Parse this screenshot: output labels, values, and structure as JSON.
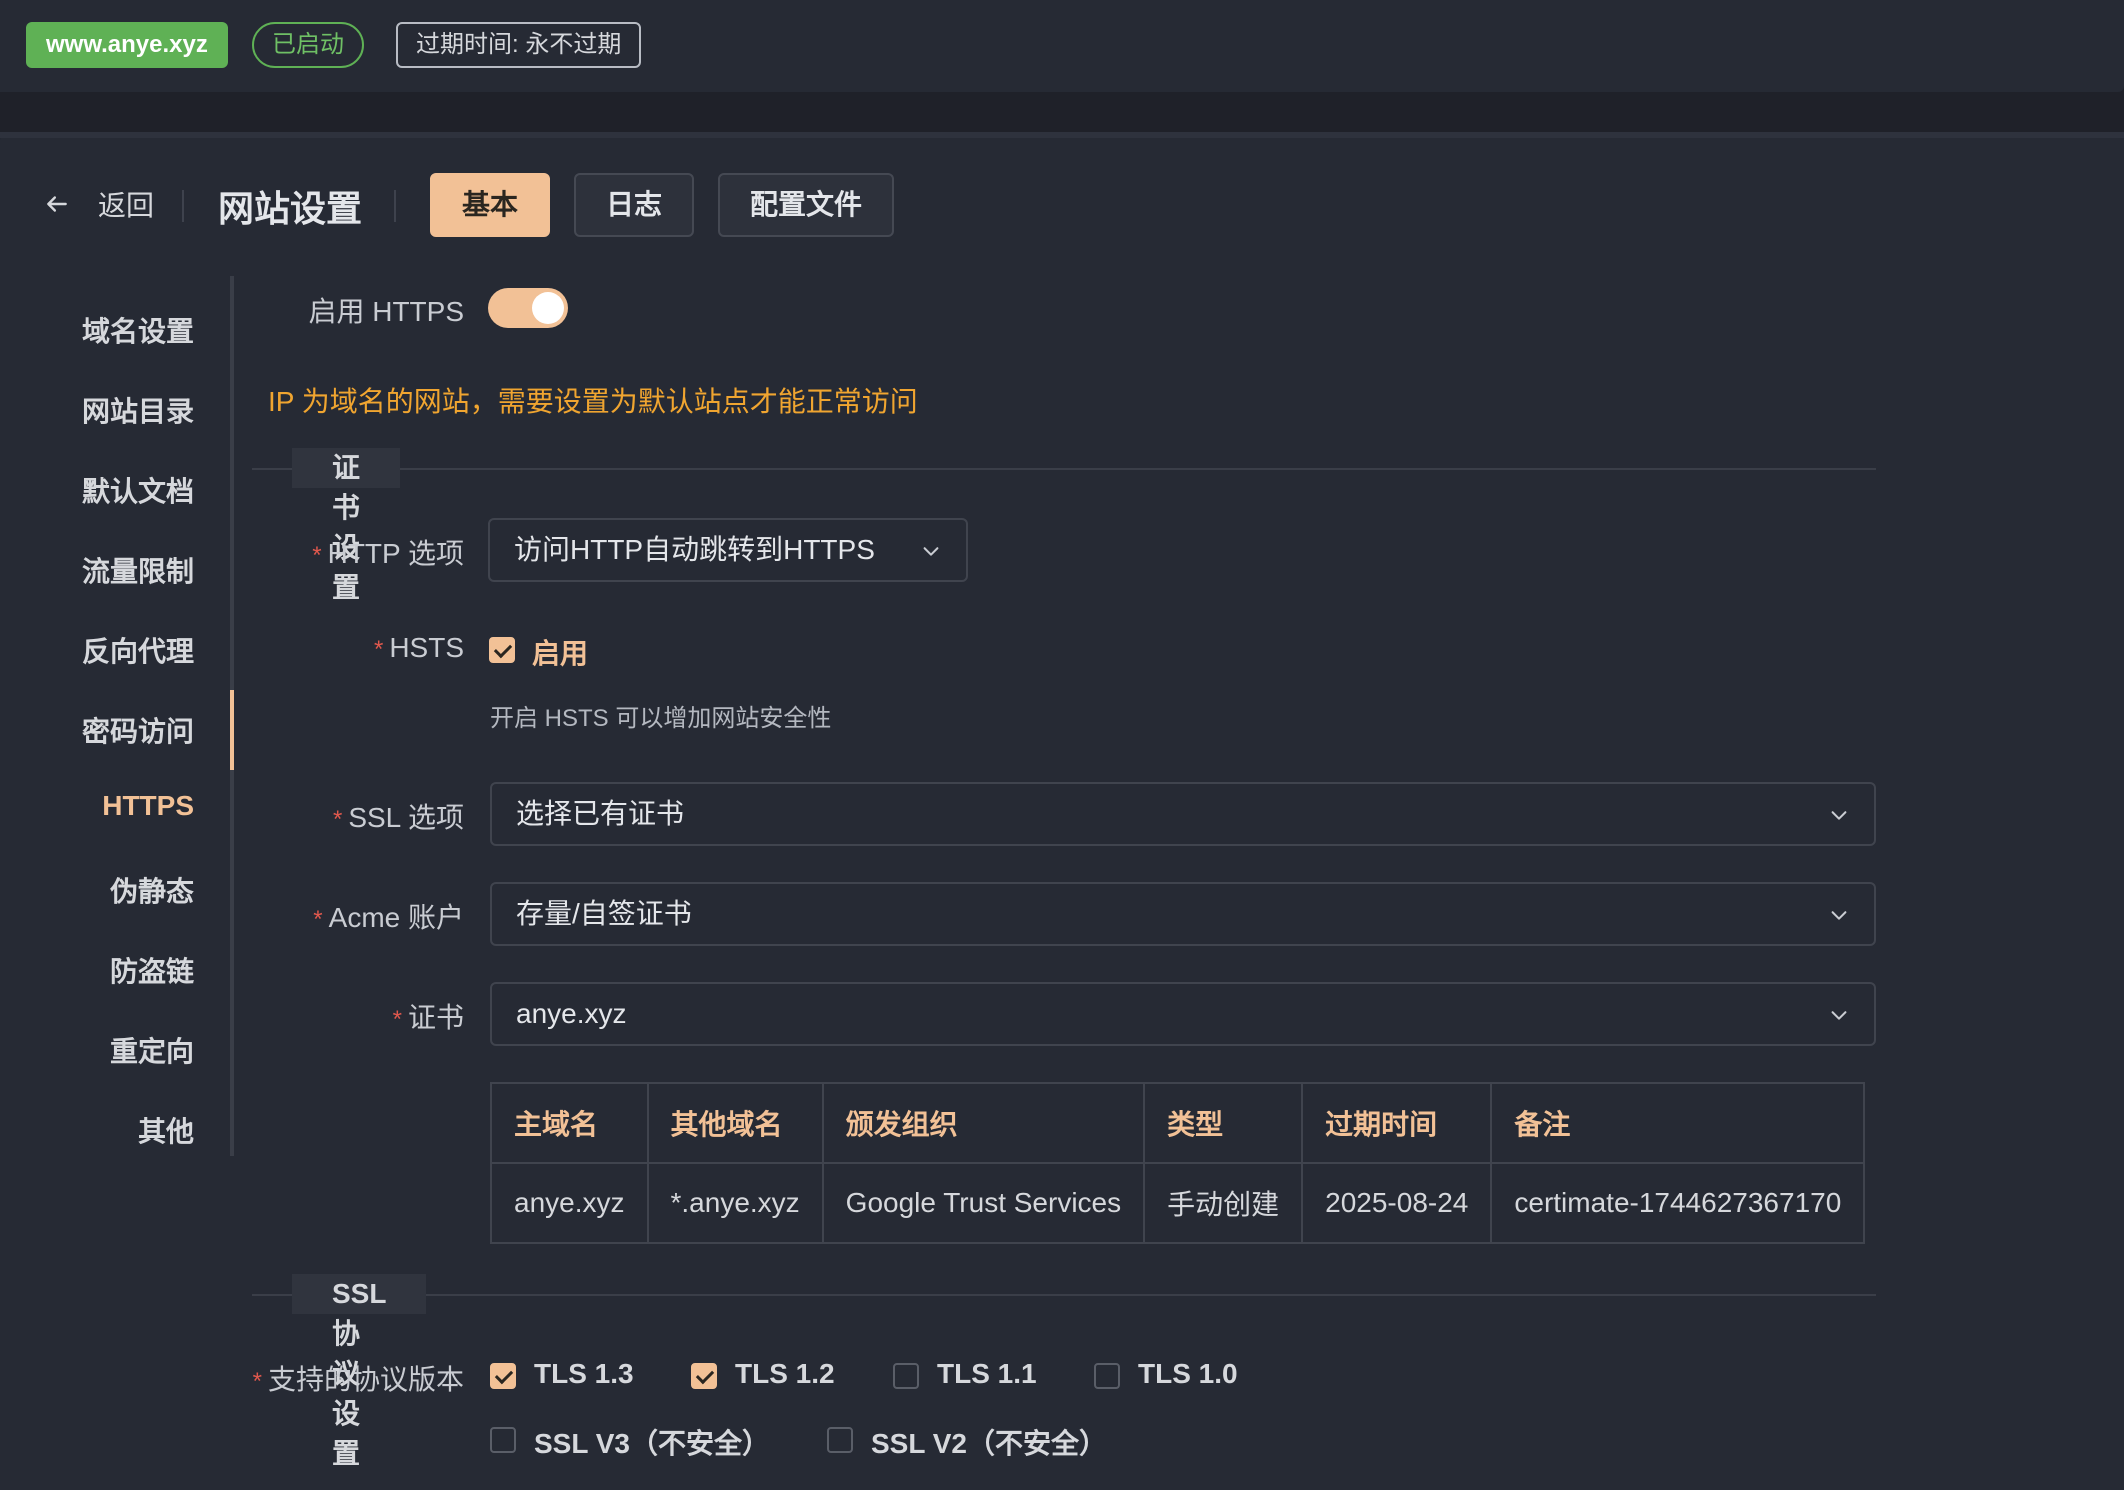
{
  "topbar": {
    "domain": "www.anye.xyz",
    "status": "已启动",
    "expire": "过期时间: 永不过期"
  },
  "header": {
    "back_label": "返回",
    "title": "网站设置",
    "tabs": [
      {
        "label": "基本",
        "active": true
      },
      {
        "label": "日志",
        "active": false
      },
      {
        "label": "配置文件",
        "active": false
      }
    ]
  },
  "sidebar": {
    "items": [
      {
        "label": "域名设置"
      },
      {
        "label": "网站目录"
      },
      {
        "label": "默认文档"
      },
      {
        "label": "流量限制"
      },
      {
        "label": "反向代理"
      },
      {
        "label": "密码访问"
      },
      {
        "label": "HTTPS",
        "active": true
      },
      {
        "label": "伪静态"
      },
      {
        "label": "防盗链"
      },
      {
        "label": "重定向"
      },
      {
        "label": "其他"
      }
    ]
  },
  "form": {
    "https_label": "启用 HTTPS",
    "https_enabled": true,
    "warning": "IP 为域名的网站，需要设置为默认站点才能正常访问",
    "cert_section_title": "证书设置",
    "http_option_label": "HTTP 选项",
    "http_option_value": "访问HTTP自动跳转到HTTPS",
    "hsts_label": "HSTS",
    "hsts_checkbox_label": "启用",
    "hsts_checked": true,
    "hsts_hint": "开启 HSTS 可以增加网站安全性",
    "ssl_option_label": "SSL 选项",
    "ssl_option_value": "选择已有证书",
    "acme_label": "Acme 账户",
    "acme_value": "存量/自签证书",
    "cert_label": "证书",
    "cert_value": "anye.xyz",
    "required_mark": "*"
  },
  "cert_table": {
    "headers": [
      "主域名",
      "其他域名",
      "颁发组织",
      "类型",
      "过期时间",
      "备注"
    ],
    "rows": [
      [
        "anye.xyz",
        "*.anye.xyz",
        "Google Trust Services",
        "手动创建",
        "2025-08-24",
        "certimate-1744627367170"
      ]
    ]
  },
  "ssl_protocol": {
    "section_title": "SSL 协议设置",
    "label": "支持的协议版本",
    "options": [
      {
        "label": "TLS 1.3",
        "checked": true
      },
      {
        "label": "TLS 1.2",
        "checked": true
      },
      {
        "label": "TLS 1.1",
        "checked": false
      },
      {
        "label": "TLS 1.0",
        "checked": false
      },
      {
        "label": "SSL V3（不安全）",
        "checked": false
      },
      {
        "label": "SSL V2（不安全）",
        "checked": false
      }
    ]
  },
  "colors": {
    "accent": "#f2c196",
    "success": "#5fb155",
    "warning": "#f0a530",
    "required": "#e0584d",
    "background": "#1f2129"
  }
}
